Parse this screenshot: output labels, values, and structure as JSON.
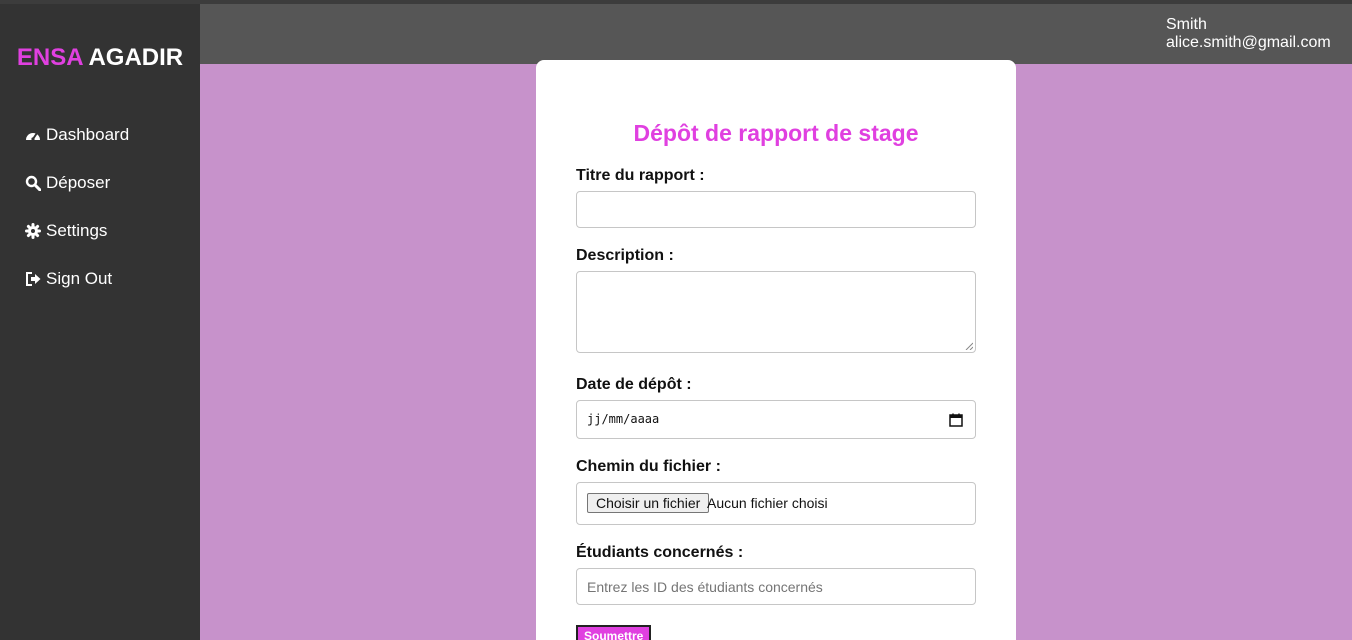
{
  "sidebar": {
    "brand_accent": "ENSA",
    "brand_rest": "AGADIR",
    "items": [
      {
        "label": "Dashboard",
        "icon": "tachometer-icon"
      },
      {
        "label": "Déposer",
        "icon": "search-icon"
      },
      {
        "label": "Settings",
        "icon": "gear-icon"
      },
      {
        "label": "Sign Out",
        "icon": "sign-out-icon"
      }
    ]
  },
  "header": {
    "user_name": "Smith",
    "user_email": "alice.smith@gmail.com"
  },
  "form": {
    "title": "Dépôt de rapport de stage",
    "title_label": "Titre du rapport :",
    "description_label": "Description :",
    "date_label": "Date de dépôt :",
    "date_placeholder": "jj/mm/aaaa",
    "file_label": "Chemin du fichier :",
    "file_button": "Choisir un fichier",
    "file_status": "Aucun fichier choisi",
    "students_label": "Étudiants concernés :",
    "students_placeholder": "Entrez les ID des étudiants concernés",
    "submit_label": "Soumettre"
  },
  "colors": {
    "accent": "#e040e0",
    "sidebar": "#333333",
    "topbar": "#565656",
    "background": "#c792cb"
  }
}
